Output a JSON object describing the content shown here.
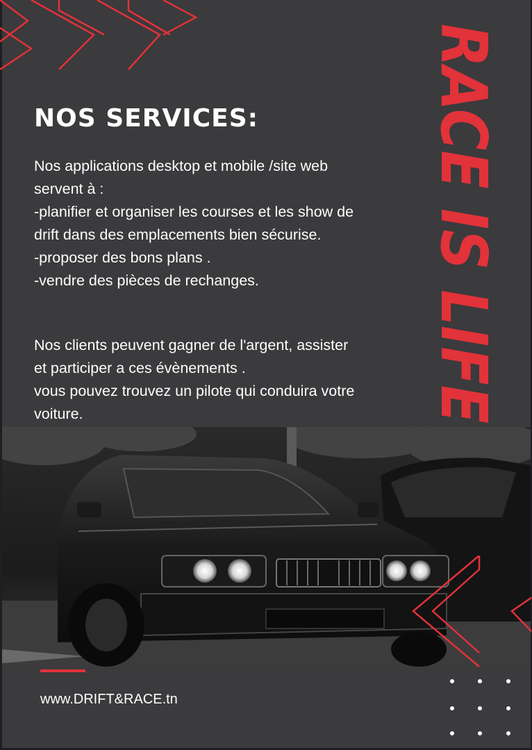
{
  "colors": {
    "background": "#3b3a3c",
    "accent": "#e2323a",
    "text": "#ffffff"
  },
  "heading": "NOS SERVICES:",
  "paragraph1": [
    "Nos applications desktop et mobile /site web",
    "servent à :",
    "-planifier et organiser les courses et les show de",
    "drift dans des emplacements bien sécurise.",
    "-proposer des bons plans .",
    "-vendre des pièces de rechanges."
  ],
  "paragraph2": [
    "Nos clients peuvent gagner de l'argent, assister",
    "et participer a ces évènements .",
    "vous pouvez trouvez un pilote qui conduira votre",
    "voiture."
  ],
  "slogan": "RACE IS LIFE",
  "website": "www.DRIFT&RACE.tn",
  "icons": [
    "chevron-decoration-icon",
    "chevron-decoration-icon",
    "dot-grid-icon"
  ]
}
